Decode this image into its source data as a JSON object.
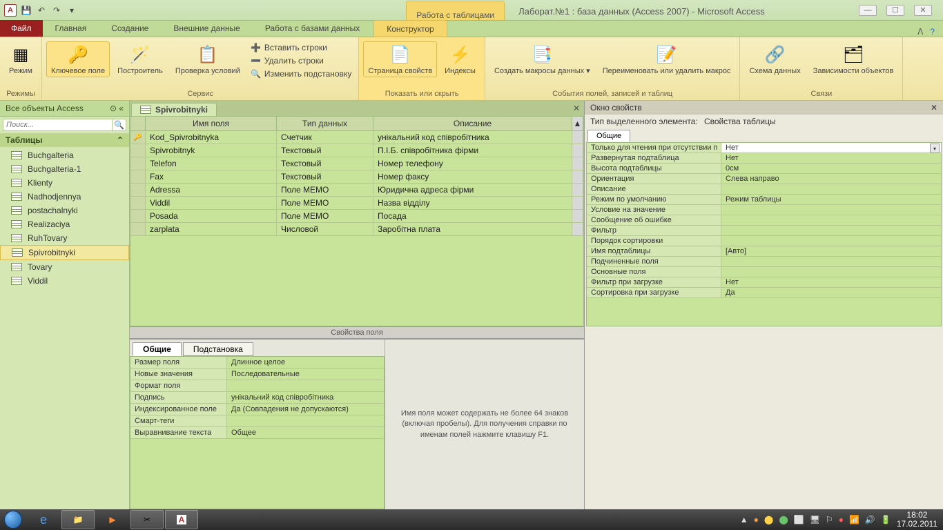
{
  "titlebar": {
    "context_group": "Работа с таблицами",
    "window_title": "Лаборат.№1 : база данных (Access 2007)  -  Microsoft Access"
  },
  "tabs": {
    "file": "Файл",
    "items": [
      "Главная",
      "Создание",
      "Внешние данные",
      "Работа с базами данных"
    ],
    "context": "Конструктор"
  },
  "ribbon": {
    "g1": {
      "view": "Режим",
      "label": "Режимы"
    },
    "g2": {
      "key": "Ключевое поле",
      "builder": "Построитель",
      "valid": "Проверка условий",
      "insert": "Вставить строки",
      "delete": "Удалить строки",
      "modify": "Изменить подстановку",
      "label": "Сервис"
    },
    "g3": {
      "prop": "Страница свойств",
      "index": "Индексы",
      "label": "Показать или скрыть"
    },
    "g4": {
      "macro": "Создать макросы данных ▾",
      "rename": "Переименовать или удалить макрос",
      "label": "События полей, записей и таблиц"
    },
    "g5": {
      "schema": "Схема данных",
      "deps": "Зависимости объектов",
      "label": "Связи"
    }
  },
  "nav": {
    "header": "Все объекты Access",
    "search_placeholder": "Поиск...",
    "section": "Таблицы",
    "items": [
      "Buchgalteria",
      "Buchgalteria-1",
      "Klienty",
      "Nadhodjennya",
      "postachalnyki",
      "Realizaciya",
      "RuhTovary",
      "Spivrobitnyki",
      "Tovary",
      "Viddil"
    ],
    "selected": "Spivrobitnyki"
  },
  "doc": {
    "tab": "Spivrobitnyki",
    "headers": {
      "name": "Имя поля",
      "type": "Тип данных",
      "desc": "Описание"
    },
    "rows": [
      {
        "key": true,
        "name": "Kod_Spivrobitnyka",
        "type": "Счетчик",
        "desc": "унікальний код співробітника"
      },
      {
        "key": false,
        "name": "Spivrobitnyk",
        "type": "Текстовый",
        "desc": "П.І.Б. співробітника фірми"
      },
      {
        "key": false,
        "name": "Telefon",
        "type": "Текстовый",
        "desc": "Номер телефону"
      },
      {
        "key": false,
        "name": "Fax",
        "type": "Текстовый",
        "desc": "Номер факсу"
      },
      {
        "key": false,
        "name": "Adressa",
        "type": "Поле МЕМО",
        "desc": "Юридична адреса фірми"
      },
      {
        "key": false,
        "name": "Viddil",
        "type": "Поле МЕМО",
        "desc": "Назва відділу"
      },
      {
        "key": false,
        "name": "Posada",
        "type": "Поле МЕМО",
        "desc": "Посада"
      },
      {
        "key": false,
        "name": "zarplata",
        "type": "Числовой",
        "desc": "Заробітна плата"
      }
    ],
    "splitter": "Свойства поля"
  },
  "fieldprops": {
    "tab_general": "Общие",
    "tab_lookup": "Подстановка",
    "rows": [
      {
        "k": "Размер поля",
        "v": "Длинное целое"
      },
      {
        "k": "Новые значения",
        "v": "Последовательные"
      },
      {
        "k": "Формат поля",
        "v": ""
      },
      {
        "k": "Подпись",
        "v": "унікальний код співробітника"
      },
      {
        "k": "Индексированное поле",
        "v": "Да (Совпадения не допускаются)"
      },
      {
        "k": "Смарт-теги",
        "v": ""
      },
      {
        "k": "Выравнивание текста",
        "v": "Общее"
      }
    ],
    "help": "Имя поля может содержать не более 64 знаков (включая пробелы). Для получения справки по именам полей нажмите клавишу F1."
  },
  "propwin": {
    "title": "Окно свойств",
    "type_label": "Тип выделенного элемента:",
    "type_value": "Свойства таблицы",
    "tab": "Общие",
    "rows": [
      {
        "k": "Только для чтения при отсутствии п",
        "v": "Нет",
        "sel": true
      },
      {
        "k": "Развернутая подтаблица",
        "v": "Нет"
      },
      {
        "k": "Высота подтаблицы",
        "v": "0см"
      },
      {
        "k": "Ориентация",
        "v": "Слева направо"
      },
      {
        "k": "Описание",
        "v": ""
      },
      {
        "k": "Режим по умолчанию",
        "v": "Режим таблицы"
      },
      {
        "k": "Условие на значение",
        "v": ""
      },
      {
        "k": "Сообщение об ошибке",
        "v": ""
      },
      {
        "k": "Фильтр",
        "v": ""
      },
      {
        "k": "Порядок сортировки",
        "v": ""
      },
      {
        "k": "Имя подтаблицы",
        "v": "[Авто]"
      },
      {
        "k": "Подчиненные поля",
        "v": ""
      },
      {
        "k": "Основные поля",
        "v": ""
      },
      {
        "k": "Фильтр при загрузке",
        "v": "Нет"
      },
      {
        "k": "Сортировка при загрузке",
        "v": "Да"
      }
    ]
  },
  "taskbar": {
    "time": "18:02",
    "date": "17.02.2011"
  }
}
